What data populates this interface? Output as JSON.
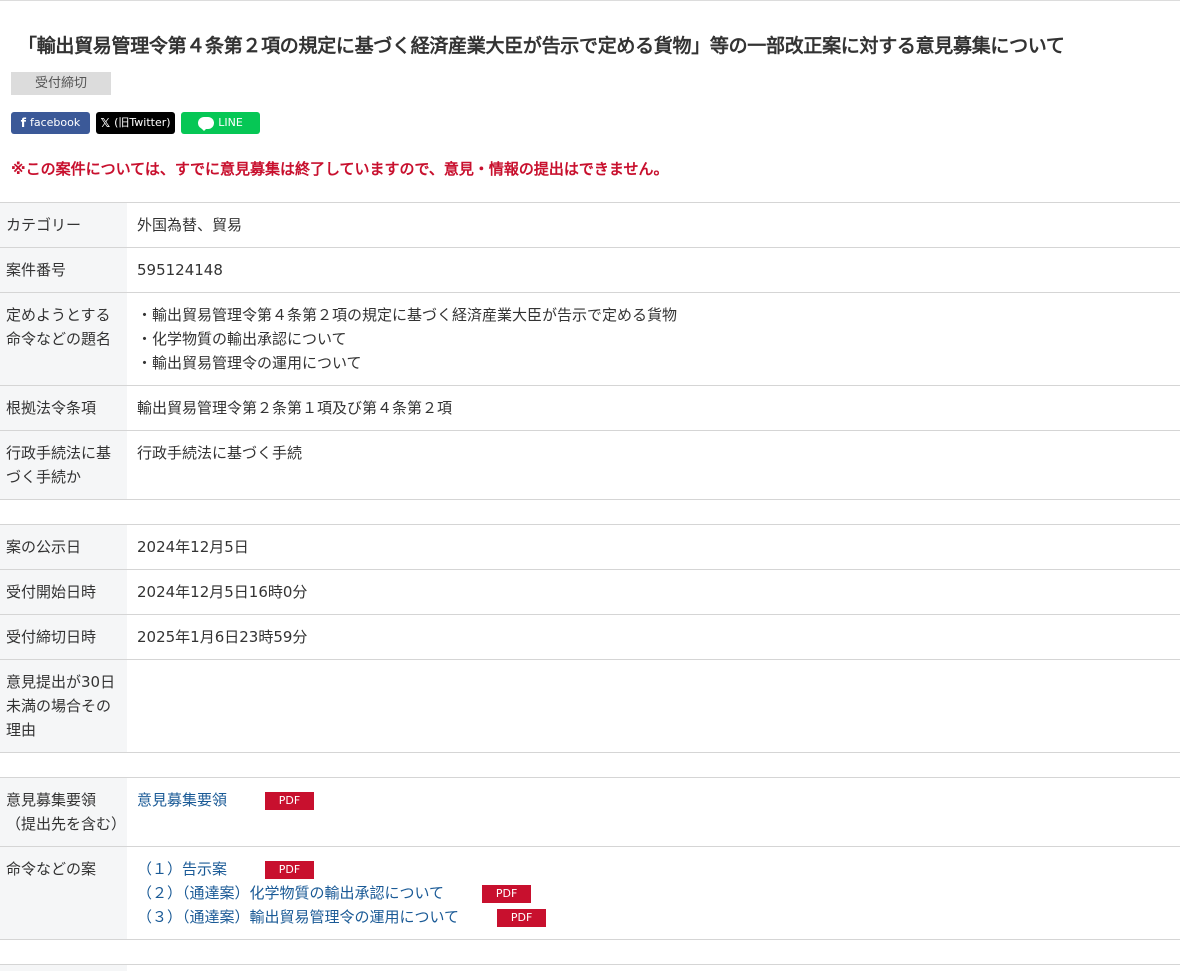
{
  "page": {
    "title": "「輸出貿易管理令第４条第２項の規定に基づく経済産業大臣が告示で定める貨物」等の一部改正案に対する意見募集について",
    "status_badge": "受付締切",
    "closed_notice": "※この案件については、すでに意見募集は終了していますので、意見・情報の提出はできません。"
  },
  "share": {
    "facebook": "facebook",
    "x": "(旧Twitter)",
    "line": "LINE",
    "colors": {
      "facebook": "#3b5998",
      "x": "#000000",
      "line": "#06c755"
    }
  },
  "details": {
    "category_label": "カテゴリー",
    "category_value": "外国為替、貿易",
    "case_no_label": "案件番号",
    "case_no_value": "595124148",
    "titles_label": "定めようとする命令などの題名",
    "titles": [
      "・輸出貿易管理令第４条第２項の規定に基づく経済産業大臣が告示で定める貨物",
      "・化学物質の輸出承認について",
      "・輸出貿易管理令の運用について"
    ],
    "basis_label": "根拠法令条項",
    "basis_value": "輸出貿易管理令第２条第１項及び第４条第２項",
    "procedure_label": "行政手続法に基づく手続か",
    "procedure_value": "行政手続法に基づく手続"
  },
  "dates": {
    "published_label": "案の公示日",
    "published_value": "2024年12月5日",
    "start_label": "受付開始日時",
    "start_value": "2024年12月5日16時0分",
    "end_label": "受付締切日時",
    "end_value": "2025年1月6日23時59分",
    "reason_label": "意見提出が30日未満の場合その理由",
    "reason_value": ""
  },
  "documents": {
    "guideline_label": "意見募集要領（提出先を含む）",
    "guideline_link": "意見募集要領",
    "draft_label": "命令などの案",
    "drafts": [
      "（１）告示案",
      "（２）（通達案）化学物質の輸出承認について",
      "（３）（通達案）輸出貿易管理令の運用について"
    ],
    "pdf_label": "PDF"
  },
  "colors": {
    "notice_red": "#c8102e",
    "link_blue": "#1a5a96",
    "pdf_red": "#c8102e"
  }
}
